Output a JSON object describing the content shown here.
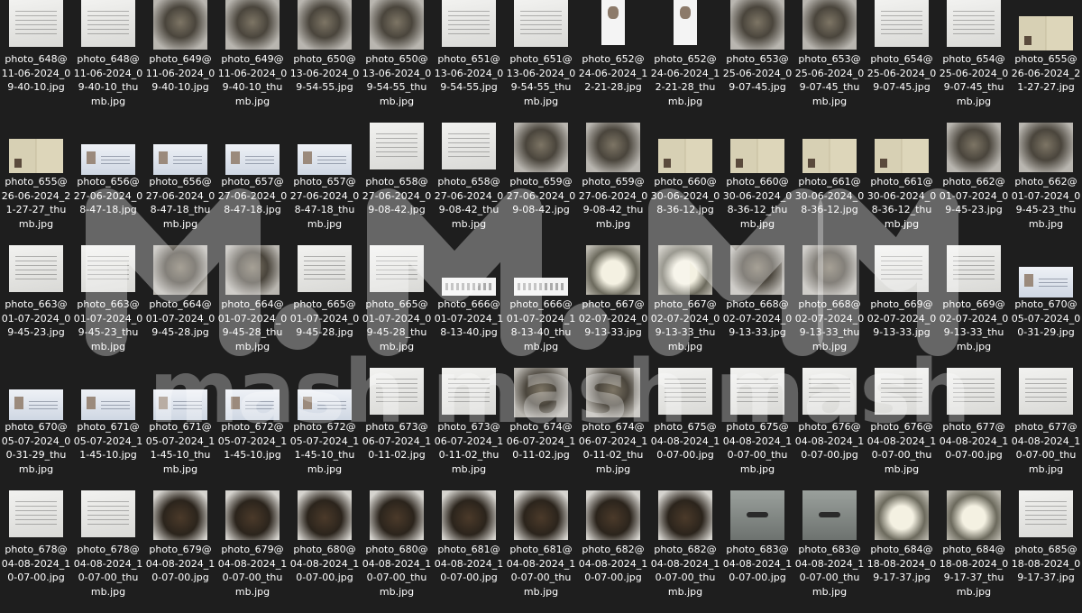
{
  "items": [
    {
      "name": "photo_648@\n11-06-2024_0\n9-40-10.jpg",
      "kind": "doc"
    },
    {
      "name": "photo_648@\n11-06-2024_0\n9-40-10_thu\nmb.jpg",
      "kind": "doc"
    },
    {
      "name": "photo_649@\n11-06-2024_0\n9-40-10.jpg",
      "kind": "body"
    },
    {
      "name": "photo_649@\n11-06-2024_0\n9-40-10_thu\nmb.jpg",
      "kind": "body"
    },
    {
      "name": "photo_650@\n13-06-2024_0\n9-54-55.jpg",
      "kind": "body"
    },
    {
      "name": "photo_650@\n13-06-2024_0\n9-54-55_thu\nmb.jpg",
      "kind": "body"
    },
    {
      "name": "photo_651@\n13-06-2024_0\n9-54-55.jpg",
      "kind": "doc"
    },
    {
      "name": "photo_651@\n13-06-2024_0\n9-54-55_thu\nmb.jpg",
      "kind": "doc"
    },
    {
      "name": "photo_652@\n24-06-2024_1\n2-21-28.jpg",
      "kind": "portrait"
    },
    {
      "name": "photo_652@\n24-06-2024_1\n2-21-28_thu\nmb.jpg",
      "kind": "portrait"
    },
    {
      "name": "photo_653@\n25-06-2024_0\n9-07-45.jpg",
      "kind": "body"
    },
    {
      "name": "photo_653@\n25-06-2024_0\n9-07-45_thu\nmb.jpg",
      "kind": "body"
    },
    {
      "name": "photo_654@\n25-06-2024_0\n9-07-45.jpg",
      "kind": "doc"
    },
    {
      "name": "photo_654@\n25-06-2024_0\n9-07-45_thu\nmb.jpg",
      "kind": "doc"
    },
    {
      "name": "photo_655@\n26-06-2024_2\n1-27-27.jpg",
      "kind": "passport"
    },
    {
      "name": "photo_655@\n26-06-2024_2\n1-27-27_thu\nmb.jpg",
      "kind": "passport"
    },
    {
      "name": "photo_656@\n27-06-2024_0\n8-47-18.jpg",
      "kind": "idcard"
    },
    {
      "name": "photo_656@\n27-06-2024_0\n8-47-18_thu\nmb.jpg",
      "kind": "idcard"
    },
    {
      "name": "photo_657@\n27-06-2024_0\n8-47-18.jpg",
      "kind": "idcard"
    },
    {
      "name": "photo_657@\n27-06-2024_0\n8-47-18_thu\nmb.jpg",
      "kind": "idcard"
    },
    {
      "name": "photo_658@\n27-06-2024_0\n9-08-42.jpg",
      "kind": "doc"
    },
    {
      "name": "photo_658@\n27-06-2024_0\n9-08-42_thu\nmb.jpg",
      "kind": "doc"
    },
    {
      "name": "photo_659@\n27-06-2024_0\n9-08-42.jpg",
      "kind": "body"
    },
    {
      "name": "photo_659@\n27-06-2024_0\n9-08-42_thu\nmb.jpg",
      "kind": "body"
    },
    {
      "name": "photo_660@\n30-06-2024_0\n8-36-12.jpg",
      "kind": "passport"
    },
    {
      "name": "photo_660@\n30-06-2024_0\n8-36-12_thu\nmb.jpg",
      "kind": "passport"
    },
    {
      "name": "photo_661@\n30-06-2024_0\n8-36-12.jpg",
      "kind": "passport"
    },
    {
      "name": "photo_661@\n30-06-2024_0\n8-36-12_thu\nmb.jpg",
      "kind": "passport"
    },
    {
      "name": "photo_662@\n01-07-2024_0\n9-45-23.jpg",
      "kind": "body"
    },
    {
      "name": "photo_662@\n01-07-2024_0\n9-45-23_thu\nmb.jpg",
      "kind": "body"
    },
    {
      "name": "photo_663@\n01-07-2024_0\n9-45-23.jpg",
      "kind": "doc"
    },
    {
      "name": "photo_663@\n01-07-2024_0\n9-45-23_thu\nmb.jpg",
      "kind": "doc"
    },
    {
      "name": "photo_664@\n01-07-2024_0\n9-45-28.jpg",
      "kind": "body"
    },
    {
      "name": "photo_664@\n01-07-2024_0\n9-45-28_thu\nmb.jpg",
      "kind": "body"
    },
    {
      "name": "photo_665@\n01-07-2024_0\n9-45-28.jpg",
      "kind": "doc"
    },
    {
      "name": "photo_665@\n01-07-2024_0\n9-45-28_thu\nmb.jpg",
      "kind": "doc"
    },
    {
      "name": "photo_666@\n01-07-2024_1\n8-13-40.jpg",
      "kind": "strip"
    },
    {
      "name": "photo_666@\n01-07-2024_1\n8-13-40_thu\nmb.jpg",
      "kind": "strip"
    },
    {
      "name": "photo_667@\n02-07-2024_0\n9-13-33.jpg",
      "kind": "label"
    },
    {
      "name": "photo_667@\n02-07-2024_0\n9-13-33_thu\nmb.jpg",
      "kind": "label"
    },
    {
      "name": "photo_668@\n02-07-2024_0\n9-13-33.jpg",
      "kind": "body"
    },
    {
      "name": "photo_668@\n02-07-2024_0\n9-13-33_thu\nmb.jpg",
      "kind": "body"
    },
    {
      "name": "photo_669@\n02-07-2024_0\n9-13-33.jpg",
      "kind": "doc"
    },
    {
      "name": "photo_669@\n02-07-2024_0\n9-13-33_thu\nmb.jpg",
      "kind": "doc"
    },
    {
      "name": "photo_670@\n05-07-2024_0\n0-31-29.jpg",
      "kind": "idcard"
    },
    {
      "name": "photo_670@\n05-07-2024_0\n0-31-29_thu\nmb.jpg",
      "kind": "idcard"
    },
    {
      "name": "photo_671@\n05-07-2024_1\n1-45-10.jpg",
      "kind": "idcard"
    },
    {
      "name": "photo_671@\n05-07-2024_1\n1-45-10_thu\nmb.jpg",
      "kind": "idcard"
    },
    {
      "name": "photo_672@\n05-07-2024_1\n1-45-10.jpg",
      "kind": "idcard"
    },
    {
      "name": "photo_672@\n05-07-2024_1\n1-45-10_thu\nmb.jpg",
      "kind": "idcard"
    },
    {
      "name": "photo_673@\n06-07-2024_1\n0-11-02.jpg",
      "kind": "doc"
    },
    {
      "name": "photo_673@\n06-07-2024_1\n0-11-02_thu\nmb.jpg",
      "kind": "doc"
    },
    {
      "name": "photo_674@\n06-07-2024_1\n0-11-02.jpg",
      "kind": "body"
    },
    {
      "name": "photo_674@\n06-07-2024_1\n0-11-02_thu\nmb.jpg",
      "kind": "body"
    },
    {
      "name": "photo_675@\n04-08-2024_1\n0-07-00.jpg",
      "kind": "doc"
    },
    {
      "name": "photo_675@\n04-08-2024_1\n0-07-00_thu\nmb.jpg",
      "kind": "doc"
    },
    {
      "name": "photo_676@\n04-08-2024_1\n0-07-00.jpg",
      "kind": "doc"
    },
    {
      "name": "photo_676@\n04-08-2024_1\n0-07-00_thu\nmb.jpg",
      "kind": "doc"
    },
    {
      "name": "photo_677@\n04-08-2024_1\n0-07-00.jpg",
      "kind": "doc"
    },
    {
      "name": "photo_677@\n04-08-2024_1\n0-07-00_thu\nmb.jpg",
      "kind": "doc"
    },
    {
      "name": "photo_678@\n04-08-2024_1\n0-07-00.jpg",
      "kind": "doc"
    },
    {
      "name": "photo_678@\n04-08-2024_1\n0-07-00_thu\nmb.jpg",
      "kind": "doc"
    },
    {
      "name": "photo_679@\n04-08-2024_1\n0-07-00.jpg",
      "kind": "bag"
    },
    {
      "name": "photo_679@\n04-08-2024_1\n0-07-00_thu\nmb.jpg",
      "kind": "bag"
    },
    {
      "name": "photo_680@\n04-08-2024_1\n0-07-00.jpg",
      "kind": "bag"
    },
    {
      "name": "photo_680@\n04-08-2024_1\n0-07-00_thu\nmb.jpg",
      "kind": "bag"
    },
    {
      "name": "photo_681@\n04-08-2024_1\n0-07-00.jpg",
      "kind": "bag"
    },
    {
      "name": "photo_681@\n04-08-2024_1\n0-07-00_thu\nmb.jpg",
      "kind": "bag"
    },
    {
      "name": "photo_682@\n04-08-2024_1\n0-07-00.jpg",
      "kind": "bag"
    },
    {
      "name": "photo_682@\n04-08-2024_1\n0-07-00_thu\nmb.jpg",
      "kind": "bag"
    },
    {
      "name": "photo_683@\n04-08-2024_1\n0-07-00.jpg",
      "kind": "crop"
    },
    {
      "name": "photo_683@\n04-08-2024_1\n0-07-00_thu\nmb.jpg",
      "kind": "crop"
    },
    {
      "name": "photo_684@\n18-08-2024_0\n9-17-37.jpg",
      "kind": "label"
    },
    {
      "name": "photo_684@\n18-08-2024_0\n9-17-37_thu\nmb.jpg",
      "kind": "label"
    },
    {
      "name": "photo_685@\n18-08-2024_0\n9-17-37.jpg",
      "kind": "doc"
    }
  ],
  "watermark": {
    "logo": "M.M.M.",
    "text": "mash mash mash",
    "color": "#ffffff"
  }
}
